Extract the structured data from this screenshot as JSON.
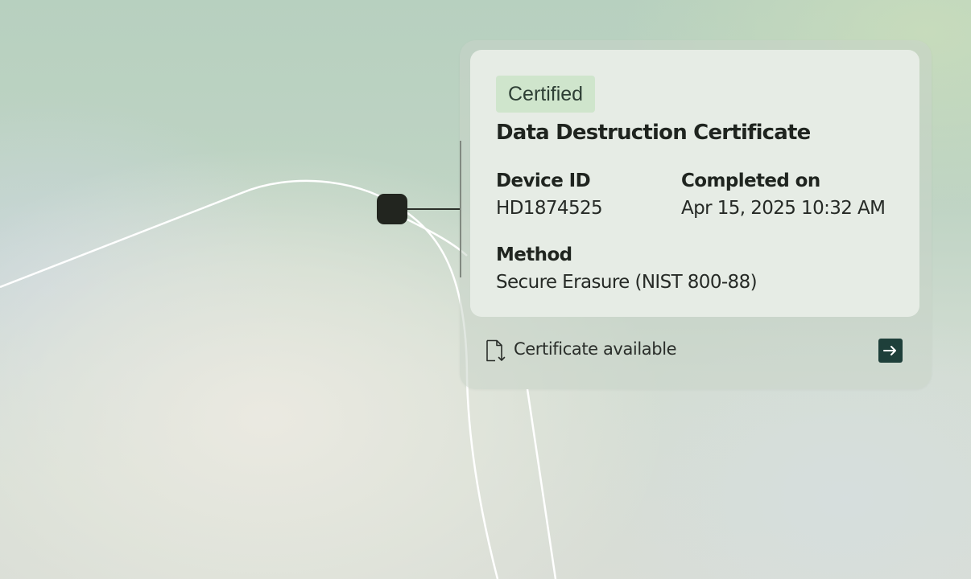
{
  "card": {
    "badge": "Certified",
    "title": "Data Destruction Certificate",
    "fields": [
      {
        "label": "Device ID",
        "value": "HD1874525"
      },
      {
        "label": "Completed on",
        "value": "Apr 15, 2025 10:32 AM"
      },
      {
        "label": "Method",
        "value": "Secure Erasure  (NIST 800-88)"
      }
    ]
  },
  "footer": {
    "icon": "file-download-icon",
    "text": "Certificate available",
    "action_icon": "arrow-right-icon"
  },
  "colors": {
    "badge_bg": "#cfe5cc",
    "button_bg": "#1e3f3a",
    "node": "#22251f"
  }
}
